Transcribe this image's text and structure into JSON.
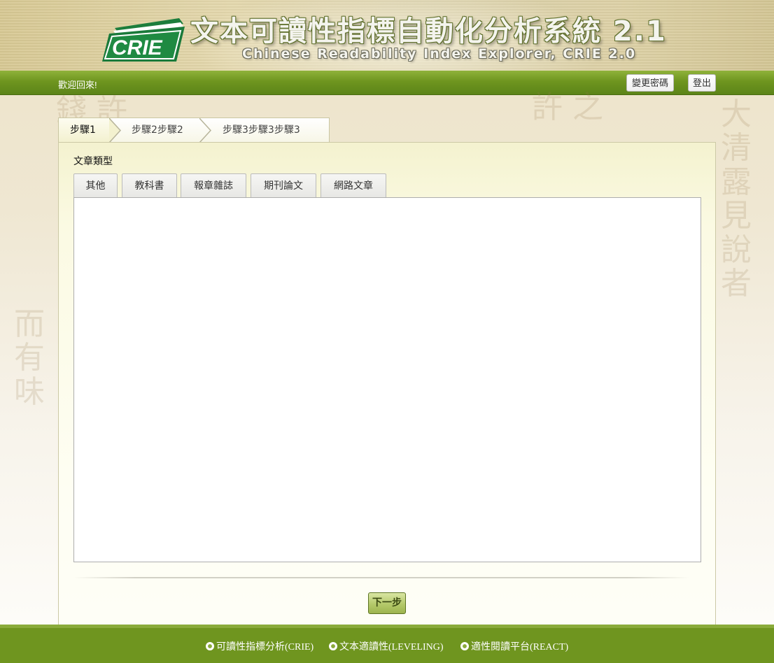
{
  "header": {
    "logo_text": "CRIE",
    "title": "文本可讀性指標自動化分析系統 2.1",
    "subtitle": "Chinese Readability Index Explorer, CRIE 2.0"
  },
  "navbar": {
    "welcome": "歡迎回來!",
    "change_password": "變更密碼",
    "logout": "登出"
  },
  "wizard": {
    "steps": [
      "步驟1",
      "步驟2步驟2",
      "步驟3步驟3步驟3"
    ],
    "active_step": 1
  },
  "form": {
    "section_label": "文章類型",
    "type_tabs": [
      "其他",
      "教科書",
      "報章雜誌",
      "期刊論文",
      "網路文章"
    ],
    "text_value": "",
    "next_button": "下一步"
  },
  "footer": {
    "links": [
      "可讀性指標分析(CRIE)",
      "文本適讀性(LEVELING)",
      "適性閱讀平台(REACT)"
    ]
  },
  "colors": {
    "nav_green": "#6e951f",
    "footer_green": "#6f951f",
    "logo_green": "#1a7a3a"
  }
}
